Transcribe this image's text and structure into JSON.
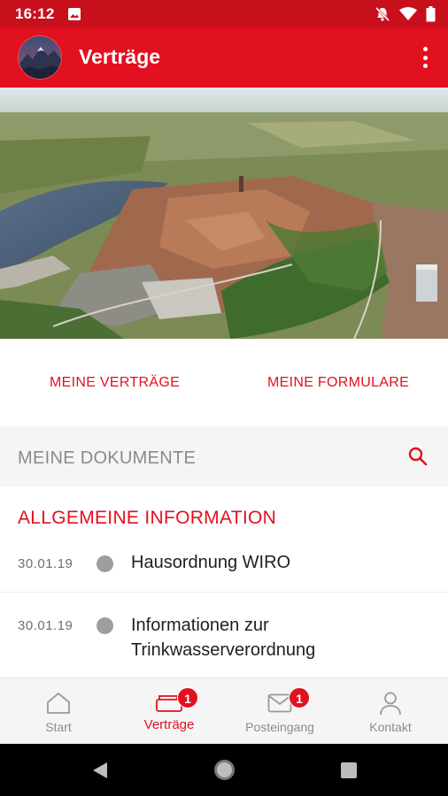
{
  "status_bar": {
    "time": "16:12"
  },
  "app_bar": {
    "title": "Verträge"
  },
  "actions": {
    "vertraege_label": "MEINE VERTRÄGE",
    "formulare_label": "MEINE FORMULARE"
  },
  "documents": {
    "title": "MEINE DOKUMENTE"
  },
  "section": {
    "title": "ALLGEMEINE INFORMATION",
    "items": [
      {
        "date": "30.01.19",
        "title": "Hausordnung WIRO"
      },
      {
        "date": "30.01.19",
        "title": "Informationen zur Trinkwasserverordnung"
      }
    ]
  },
  "bottom_nav": {
    "items": [
      {
        "label": "Start",
        "icon": "home-icon"
      },
      {
        "label": "Verträge",
        "icon": "contracts-icon",
        "badge": "1",
        "active": true
      },
      {
        "label": "Posteingang",
        "icon": "mail-icon",
        "badge": "1"
      },
      {
        "label": "Kontakt",
        "icon": "person-icon"
      }
    ]
  },
  "colors": {
    "brand_red": "#e2111f",
    "status_red": "#c8101d",
    "muted_grey": "#8c8c8c"
  }
}
